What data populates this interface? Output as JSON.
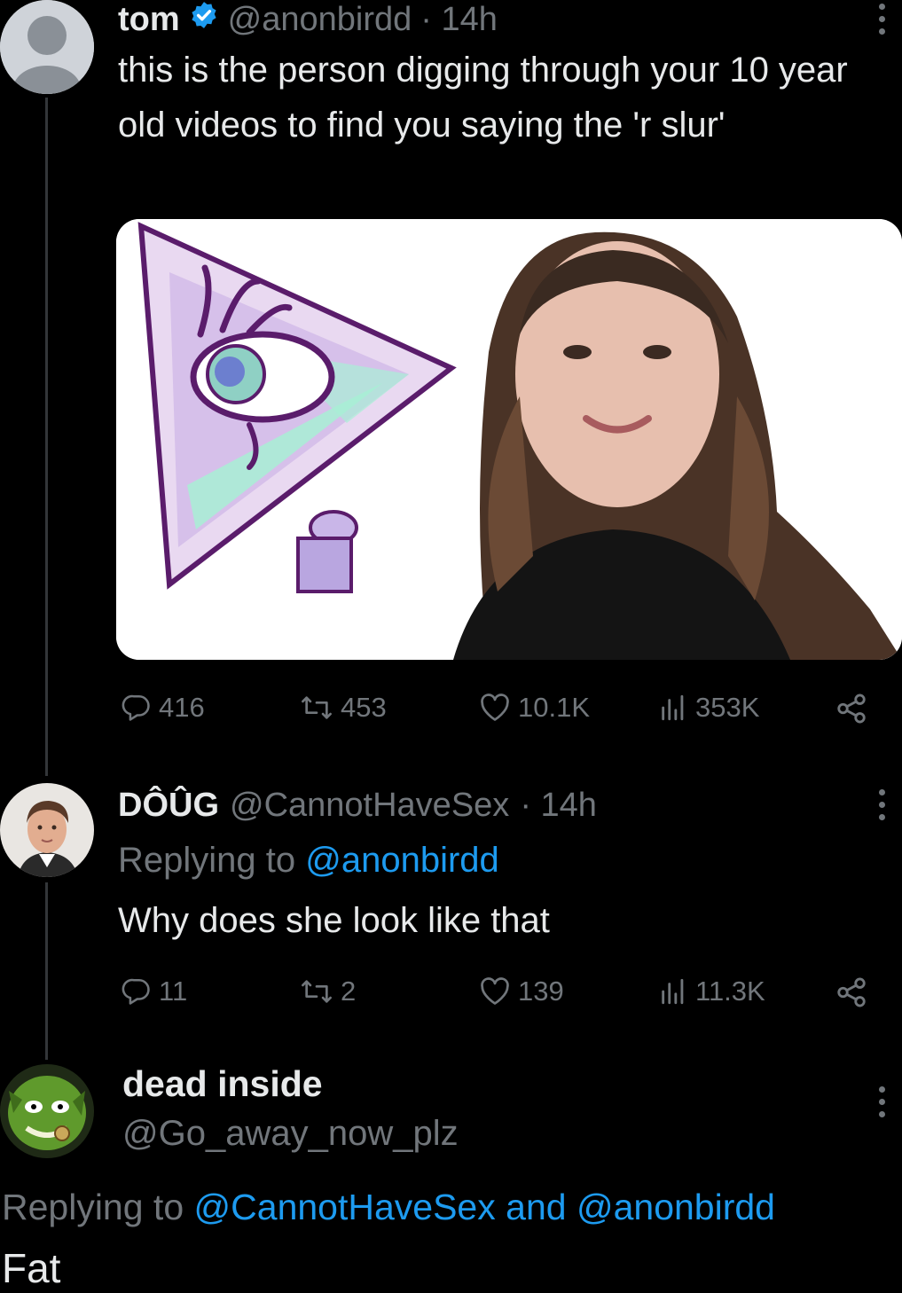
{
  "tweet1": {
    "display_name": "tom",
    "handle": "@anonbirdd",
    "time": "· 14h",
    "text": "this is the person digging through your 10 year old videos to find you saying the 'r slur'",
    "metrics": {
      "replies": "416",
      "retweets": "453",
      "likes": "10.1K",
      "views": "353K"
    }
  },
  "tweet2": {
    "display_name": "DÔÛG",
    "handle": "@CannotHaveSex",
    "time": "· 14h",
    "replying_prefix": "Replying to",
    "replying_to": "@anonbirdd",
    "text": "Why does she look like that",
    "metrics": {
      "replies": "11",
      "retweets": "2",
      "likes": "139",
      "views": "11.3K"
    }
  },
  "tweet3": {
    "display_name": "dead inside",
    "handle": "@Go_away_now_plz",
    "replying_prefix": "Replying to",
    "replying_to_1": "@CannotHaveSex",
    "replying_and": "and",
    "replying_to_2": "@anonbirdd",
    "text": "Fat"
  },
  "colors": {
    "background": "#000000",
    "text": "#e7e9ea",
    "muted": "#71767b",
    "link": "#1d9bf0",
    "verified": "#1d9bf0"
  },
  "icons": [
    "more-icon",
    "verified-icon",
    "reply-icon",
    "retweet-icon",
    "like-icon",
    "views-icon",
    "share-icon"
  ]
}
